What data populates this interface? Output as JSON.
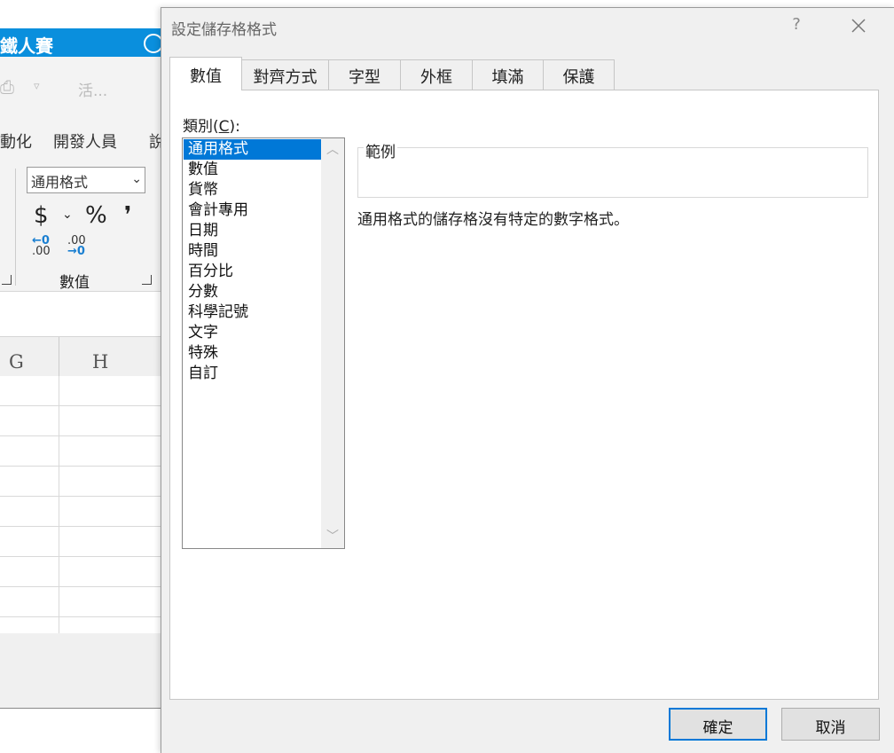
{
  "excel": {
    "title_fragment": "鐵人賽",
    "qat": {
      "search_hint": "活..."
    },
    "ribbon_tabs": [
      "動化",
      "開發人員",
      "說"
    ],
    "number_format_value": "通用格式",
    "currency_symbol": "$",
    "percent_symbol": "%",
    "comma_symbol": "❜",
    "increase_decimal": {
      "top": "←0",
      "bottom": ".00"
    },
    "decrease_decimal": {
      "top": ".00",
      "bottom": "→0"
    },
    "group_label": "數值",
    "columns": [
      "G",
      "H"
    ]
  },
  "dialog": {
    "title": "設定儲存格格式",
    "help_label": "?",
    "tabs": [
      {
        "label": "數值",
        "active": true
      },
      {
        "label": "對齊方式",
        "active": false
      },
      {
        "label": "字型",
        "active": false
      },
      {
        "label": "外框",
        "active": false
      },
      {
        "label": "填滿",
        "active": false
      },
      {
        "label": "保護",
        "active": false
      }
    ],
    "category_label_prefix": "類別(",
    "category_label_key": "C",
    "category_label_suffix": "):",
    "categories": [
      "通用格式",
      "數值",
      "貨幣",
      "會計專用",
      "日期",
      "時間",
      "百分比",
      "分數",
      "科學記號",
      "文字",
      "特殊",
      "自訂"
    ],
    "selected_category": "通用格式",
    "sample_label": "範例",
    "sample_value": "",
    "description": "通用格式的儲存格沒有特定的數字格式。",
    "ok_label": "確定",
    "cancel_label": "取消"
  }
}
